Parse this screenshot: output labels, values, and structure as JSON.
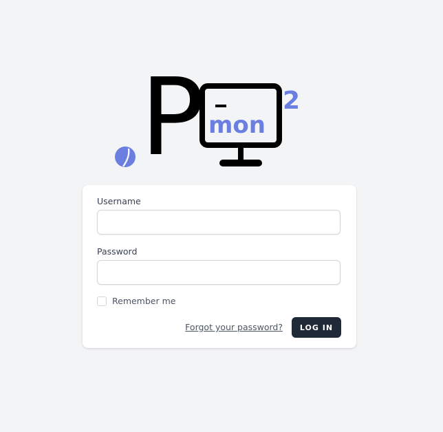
{
  "logo": {
    "letter": "P",
    "monitor_text": "mon",
    "superscript": "2",
    "icons": [
      "leaf-dot-icon",
      "monitor-icon"
    ],
    "accent_color": "#6b7fe0"
  },
  "form": {
    "username": {
      "label": "Username",
      "value": "",
      "placeholder": ""
    },
    "password": {
      "label": "Password",
      "value": "",
      "placeholder": ""
    },
    "remember": {
      "label": "Remember me",
      "checked": false
    },
    "forgot_label": "Forgot your password?",
    "login_label": "LOG IN"
  },
  "colors": {
    "background": "#f3f4f6",
    "card": "#ffffff",
    "button": "#1f2937",
    "text": "#374151"
  }
}
